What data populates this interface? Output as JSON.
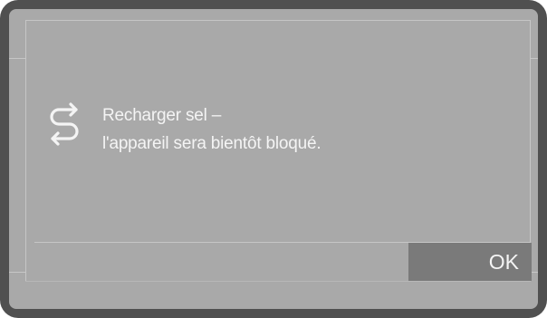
{
  "screen": {
    "message_line1": "Recharger sel –",
    "message_line2": "l'appareil sera bientôt bloqué.",
    "icon": "salt-refill-icon",
    "ok_label": "OK"
  },
  "colors": {
    "frame": "#505050",
    "screen_background": "#a9a9a9",
    "text": "#f4f4f4",
    "button_background": "#7a7a7a",
    "lines": "#c6c6c6"
  }
}
